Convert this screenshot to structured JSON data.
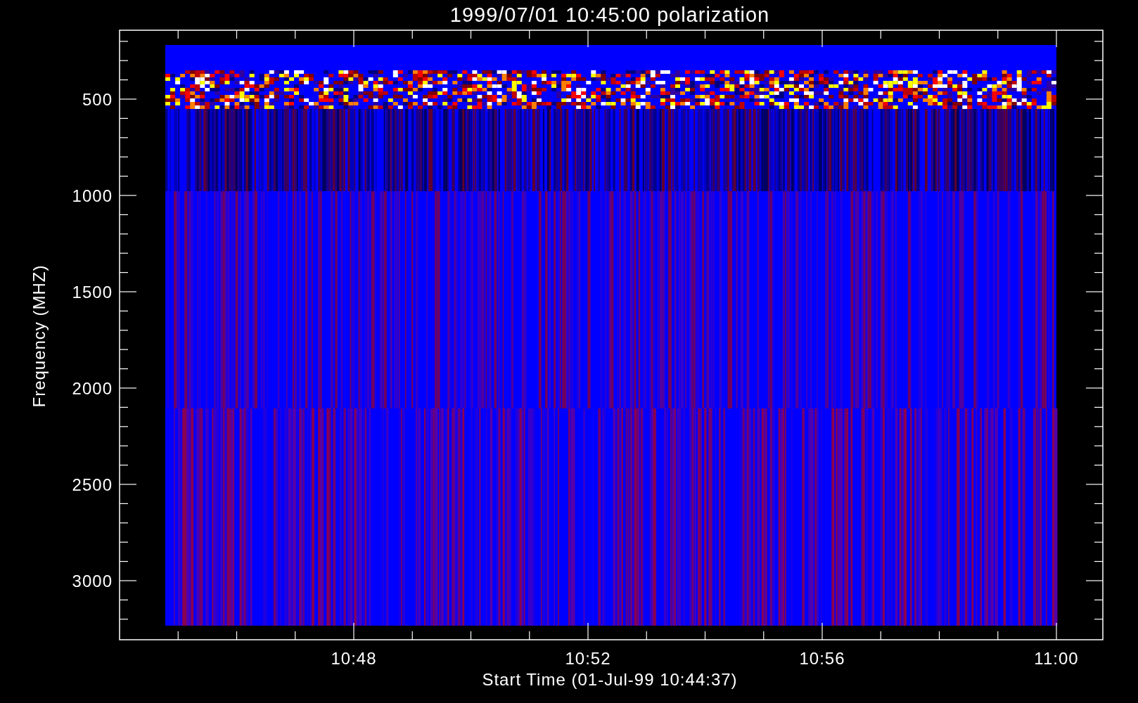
{
  "plot": {
    "title": "1999/07/01 10:45:00 polarization",
    "y_axis": {
      "label": "Frequency (MHZ)",
      "tick_labels": [
        "500",
        "1000",
        "1500",
        "2000",
        "2500",
        "3000"
      ]
    },
    "x_axis": {
      "label": "Start Time (01-Jul-99 10:44:37)",
      "tick_labels": [
        "10:48",
        "10:52",
        "10:56",
        "11:00"
      ]
    }
  }
}
